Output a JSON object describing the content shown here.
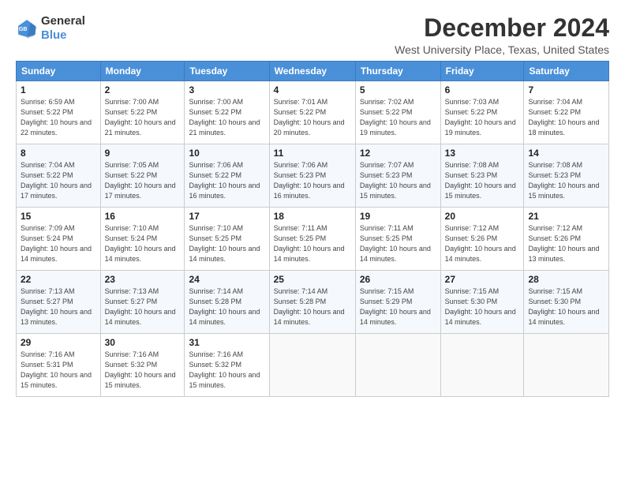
{
  "logo": {
    "line1": "General",
    "line2": "Blue"
  },
  "title": "December 2024",
  "subtitle": "West University Place, Texas, United States",
  "headers": [
    "Sunday",
    "Monday",
    "Tuesday",
    "Wednesday",
    "Thursday",
    "Friday",
    "Saturday"
  ],
  "weeks": [
    [
      {
        "day": "1",
        "sunrise": "Sunrise: 6:59 AM",
        "sunset": "Sunset: 5:22 PM",
        "daylight": "Daylight: 10 hours and 22 minutes."
      },
      {
        "day": "2",
        "sunrise": "Sunrise: 7:00 AM",
        "sunset": "Sunset: 5:22 PM",
        "daylight": "Daylight: 10 hours and 21 minutes."
      },
      {
        "day": "3",
        "sunrise": "Sunrise: 7:00 AM",
        "sunset": "Sunset: 5:22 PM",
        "daylight": "Daylight: 10 hours and 21 minutes."
      },
      {
        "day": "4",
        "sunrise": "Sunrise: 7:01 AM",
        "sunset": "Sunset: 5:22 PM",
        "daylight": "Daylight: 10 hours and 20 minutes."
      },
      {
        "day": "5",
        "sunrise": "Sunrise: 7:02 AM",
        "sunset": "Sunset: 5:22 PM",
        "daylight": "Daylight: 10 hours and 19 minutes."
      },
      {
        "day": "6",
        "sunrise": "Sunrise: 7:03 AM",
        "sunset": "Sunset: 5:22 PM",
        "daylight": "Daylight: 10 hours and 19 minutes."
      },
      {
        "day": "7",
        "sunrise": "Sunrise: 7:04 AM",
        "sunset": "Sunset: 5:22 PM",
        "daylight": "Daylight: 10 hours and 18 minutes."
      }
    ],
    [
      {
        "day": "8",
        "sunrise": "Sunrise: 7:04 AM",
        "sunset": "Sunset: 5:22 PM",
        "daylight": "Daylight: 10 hours and 17 minutes."
      },
      {
        "day": "9",
        "sunrise": "Sunrise: 7:05 AM",
        "sunset": "Sunset: 5:22 PM",
        "daylight": "Daylight: 10 hours and 17 minutes."
      },
      {
        "day": "10",
        "sunrise": "Sunrise: 7:06 AM",
        "sunset": "Sunset: 5:22 PM",
        "daylight": "Daylight: 10 hours and 16 minutes."
      },
      {
        "day": "11",
        "sunrise": "Sunrise: 7:06 AM",
        "sunset": "Sunset: 5:23 PM",
        "daylight": "Daylight: 10 hours and 16 minutes."
      },
      {
        "day": "12",
        "sunrise": "Sunrise: 7:07 AM",
        "sunset": "Sunset: 5:23 PM",
        "daylight": "Daylight: 10 hours and 15 minutes."
      },
      {
        "day": "13",
        "sunrise": "Sunrise: 7:08 AM",
        "sunset": "Sunset: 5:23 PM",
        "daylight": "Daylight: 10 hours and 15 minutes."
      },
      {
        "day": "14",
        "sunrise": "Sunrise: 7:08 AM",
        "sunset": "Sunset: 5:23 PM",
        "daylight": "Daylight: 10 hours and 15 minutes."
      }
    ],
    [
      {
        "day": "15",
        "sunrise": "Sunrise: 7:09 AM",
        "sunset": "Sunset: 5:24 PM",
        "daylight": "Daylight: 10 hours and 14 minutes."
      },
      {
        "day": "16",
        "sunrise": "Sunrise: 7:10 AM",
        "sunset": "Sunset: 5:24 PM",
        "daylight": "Daylight: 10 hours and 14 minutes."
      },
      {
        "day": "17",
        "sunrise": "Sunrise: 7:10 AM",
        "sunset": "Sunset: 5:25 PM",
        "daylight": "Daylight: 10 hours and 14 minutes."
      },
      {
        "day": "18",
        "sunrise": "Sunrise: 7:11 AM",
        "sunset": "Sunset: 5:25 PM",
        "daylight": "Daylight: 10 hours and 14 minutes."
      },
      {
        "day": "19",
        "sunrise": "Sunrise: 7:11 AM",
        "sunset": "Sunset: 5:25 PM",
        "daylight": "Daylight: 10 hours and 14 minutes."
      },
      {
        "day": "20",
        "sunrise": "Sunrise: 7:12 AM",
        "sunset": "Sunset: 5:26 PM",
        "daylight": "Daylight: 10 hours and 14 minutes."
      },
      {
        "day": "21",
        "sunrise": "Sunrise: 7:12 AM",
        "sunset": "Sunset: 5:26 PM",
        "daylight": "Daylight: 10 hours and 13 minutes."
      }
    ],
    [
      {
        "day": "22",
        "sunrise": "Sunrise: 7:13 AM",
        "sunset": "Sunset: 5:27 PM",
        "daylight": "Daylight: 10 hours and 13 minutes."
      },
      {
        "day": "23",
        "sunrise": "Sunrise: 7:13 AM",
        "sunset": "Sunset: 5:27 PM",
        "daylight": "Daylight: 10 hours and 14 minutes."
      },
      {
        "day": "24",
        "sunrise": "Sunrise: 7:14 AM",
        "sunset": "Sunset: 5:28 PM",
        "daylight": "Daylight: 10 hours and 14 minutes."
      },
      {
        "day": "25",
        "sunrise": "Sunrise: 7:14 AM",
        "sunset": "Sunset: 5:28 PM",
        "daylight": "Daylight: 10 hours and 14 minutes."
      },
      {
        "day": "26",
        "sunrise": "Sunrise: 7:15 AM",
        "sunset": "Sunset: 5:29 PM",
        "daylight": "Daylight: 10 hours and 14 minutes."
      },
      {
        "day": "27",
        "sunrise": "Sunrise: 7:15 AM",
        "sunset": "Sunset: 5:30 PM",
        "daylight": "Daylight: 10 hours and 14 minutes."
      },
      {
        "day": "28",
        "sunrise": "Sunrise: 7:15 AM",
        "sunset": "Sunset: 5:30 PM",
        "daylight": "Daylight: 10 hours and 14 minutes."
      }
    ],
    [
      {
        "day": "29",
        "sunrise": "Sunrise: 7:16 AM",
        "sunset": "Sunset: 5:31 PM",
        "daylight": "Daylight: 10 hours and 15 minutes."
      },
      {
        "day": "30",
        "sunrise": "Sunrise: 7:16 AM",
        "sunset": "Sunset: 5:32 PM",
        "daylight": "Daylight: 10 hours and 15 minutes."
      },
      {
        "day": "31",
        "sunrise": "Sunrise: 7:16 AM",
        "sunset": "Sunset: 5:32 PM",
        "daylight": "Daylight: 10 hours and 15 minutes."
      },
      null,
      null,
      null,
      null
    ]
  ]
}
